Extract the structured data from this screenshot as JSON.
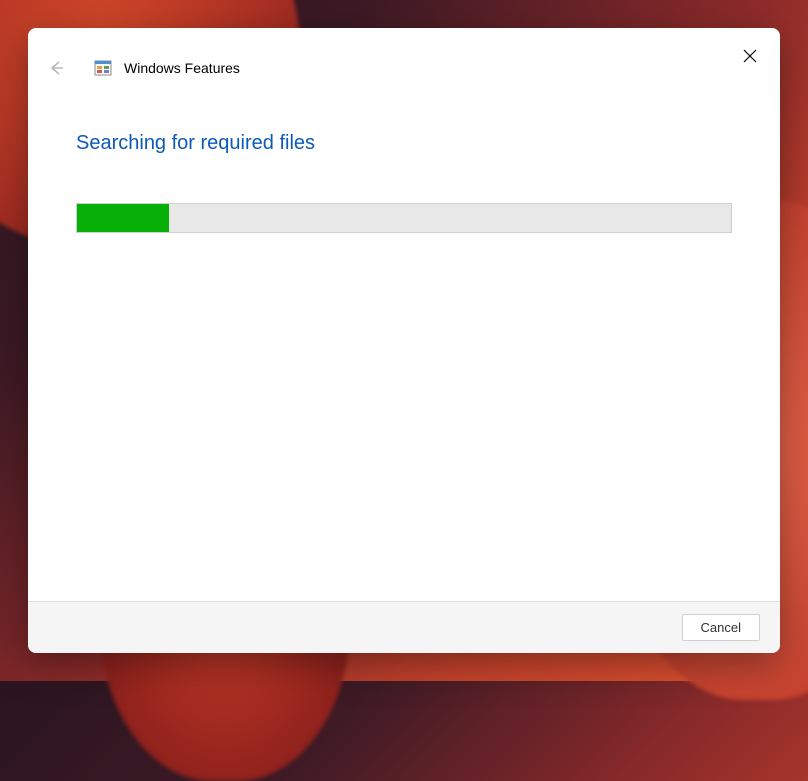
{
  "window": {
    "title": "Windows Features"
  },
  "content": {
    "heading": "Searching for required files",
    "progress_percent": 14
  },
  "footer": {
    "cancel_label": "Cancel"
  }
}
